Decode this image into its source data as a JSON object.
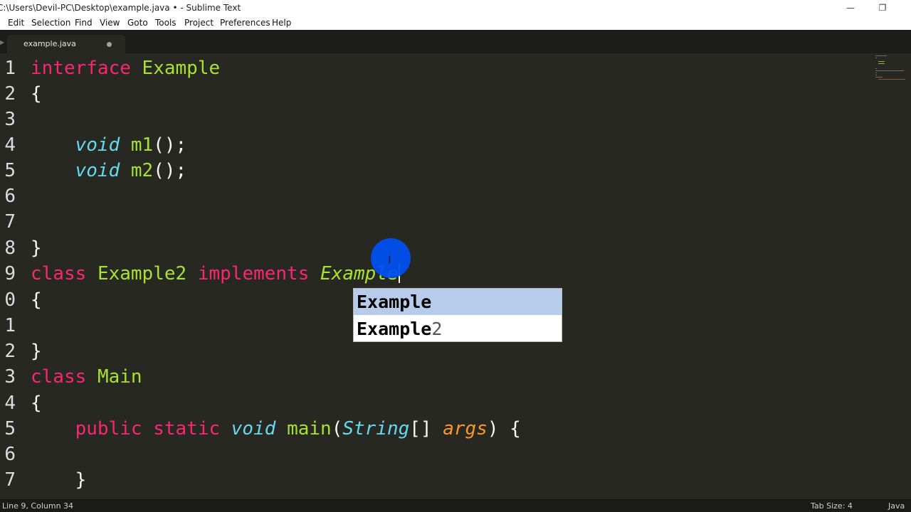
{
  "window": {
    "title": "C:\\Users\\Devil-PC\\Desktop\\example.java • - Sublime Text",
    "minimize_glyph": "—",
    "restore_glyph": "❐"
  },
  "menu": [
    "Edit",
    "Selection",
    "Find",
    "View",
    "Goto",
    "Tools",
    "Project",
    "Preferences",
    "Help"
  ],
  "tab": {
    "label": "example.java"
  },
  "gutter": [
    "1",
    "2",
    "3",
    "4",
    "5",
    "6",
    "7",
    "8",
    "9",
    "0",
    "1",
    "2",
    "3",
    "4",
    "5",
    "6",
    "7"
  ],
  "code": {
    "l1_kw": "interface",
    "l1_name": "Example",
    "l2": "{",
    "l4_type": "void",
    "l4_fn": "m1",
    "l4_rest": "();",
    "l5_type": "void",
    "l5_fn": "m2",
    "l5_rest": "();",
    "l8": "}",
    "l9_kw": "class",
    "l9_name": "Example2",
    "l9_kw2": "implements",
    "l9_typed": "Example",
    "l10": "{",
    "l12": "}",
    "l13_kw": "class",
    "l13_name": "Main",
    "l14": "{",
    "l15_mod1": "public",
    "l15_mod2": "static",
    "l15_type": "void",
    "l15_fn": "main",
    "l15_open": "(",
    "l15_ptype": "String",
    "l15_brackets": "[]",
    "l15_arg": "args",
    "l15_close": ") {",
    "l17": "}"
  },
  "autocomplete": {
    "items": [
      {
        "match": "Example",
        "rest": ""
      },
      {
        "match": "Example",
        "rest": "2"
      }
    ]
  },
  "status": {
    "position": "Line 9, Column 34",
    "tab_size": "Tab Size: 4",
    "syntax": "Java"
  },
  "colors": {
    "background": "#272822",
    "keyword": "#f92672",
    "type": "#66d9ef",
    "function": "#a6e22e",
    "argument": "#fd971f",
    "popup_selected": "#b6ccea"
  }
}
